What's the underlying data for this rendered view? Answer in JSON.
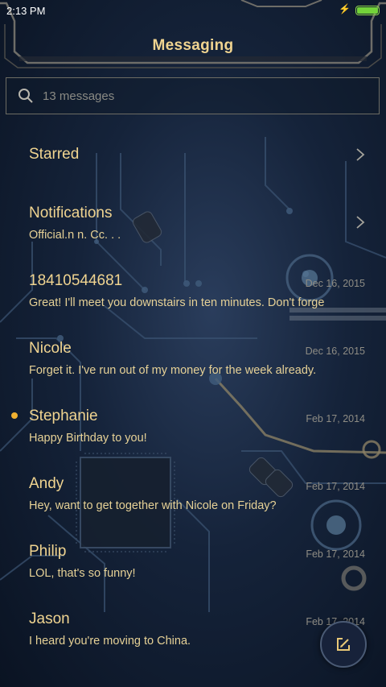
{
  "status_bar": {
    "time": "2:13 PM",
    "battery_level": 1.0,
    "battery_color": "#73d33a",
    "charging_icon": "bolt-icon"
  },
  "header": {
    "title": "Messaging"
  },
  "search": {
    "icon": "search-icon",
    "text": "13 messages"
  },
  "colors": {
    "accent": "#f0d490",
    "date": "#8e8c84",
    "unread": "#f0b030"
  },
  "conversations": [
    {
      "name": "Starred",
      "preview": "",
      "date": "",
      "chevron": true,
      "unread": false
    },
    {
      "name": "Notifications",
      "preview": "Official.n n.  Cc.   .   .",
      "date": "",
      "chevron": true,
      "unread": false
    },
    {
      "name": "18410544681",
      "preview": "Great! I'll meet you downstairs in ten minutes. Don't forge",
      "date": "Dec 16, 2015",
      "chevron": false,
      "unread": false
    },
    {
      "name": "Nicole",
      "preview": "Forget it. I've run out of my money for the week already.",
      "date": "Dec 16, 2015",
      "chevron": false,
      "unread": false
    },
    {
      "name": "Stephanie",
      "preview": "Happy Birthday to you!",
      "date": "Feb 17, 2014",
      "chevron": false,
      "unread": true
    },
    {
      "name": "Andy",
      "preview": "Hey, want to get together with Nicole on Friday?",
      "date": "Feb 17, 2014",
      "chevron": false,
      "unread": false
    },
    {
      "name": "Philip",
      "preview": "LOL, that's so funny!",
      "date": "Feb 17, 2014",
      "chevron": false,
      "unread": false
    },
    {
      "name": "Jason",
      "preview": "I heard you're moving to China.",
      "date": "Feb 17, 2014",
      "chevron": false,
      "unread": false
    }
  ],
  "compose": {
    "icon": "compose-icon"
  }
}
